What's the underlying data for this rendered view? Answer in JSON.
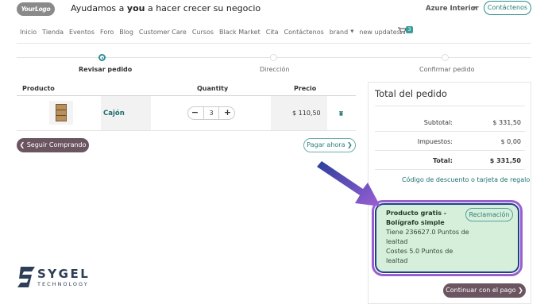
{
  "header": {
    "logo_text": "YourLogo",
    "tagline_pre": "Ayudamos a ",
    "tagline_bold": "you",
    "tagline_post": " a hacer crecer su negocio",
    "company": "Azure Interior",
    "contact_button": "Contáctenos"
  },
  "nav": {
    "items": [
      "Inicio",
      "Tienda",
      "Eventos",
      "Foro",
      "Blog",
      "Customer Care",
      "Cursos",
      "Black Market",
      "Cita",
      "Contáctenos",
      "brand",
      "new updates"
    ],
    "cart_count": "3"
  },
  "steps": [
    {
      "label": "Revisar pedido",
      "active": true
    },
    {
      "label": "Dirección",
      "active": false
    },
    {
      "label": "Confirmar pedido",
      "active": false
    }
  ],
  "table": {
    "headers": {
      "product": "Producto",
      "quantity": "Quantity",
      "price": "Precio"
    },
    "rows": [
      {
        "name": "Cajón",
        "quantity": "3",
        "price": "$ 110,50"
      }
    ]
  },
  "actions": {
    "continue_shopping": "Seguir Comprando",
    "pay_now": "Pagar ahora",
    "continue_payment": "Continuar con el pago"
  },
  "summary": {
    "title": "Total del pedido",
    "subtotal_label": "Subtotal:",
    "subtotal_value": "$ 331,50",
    "taxes_label": "Impuestos:",
    "taxes_value": "$ 0,00",
    "total_label": "Total:",
    "total_value": "$ 331,50",
    "discount_link": "Código de descuento o tarjeta de regalo"
  },
  "promo": {
    "title_line1": "Producto gratis -",
    "title_line2": "Bolígrafo simple",
    "points_line1": "Tiene 236627.0 Puntos de",
    "points_line2": "lealtad",
    "cost_line1": "Costes 5.0 Puntos de",
    "cost_line2": "lealtad",
    "claim_button": "Reclamación"
  },
  "watermark": {
    "name": "SYGEL",
    "sub": "TECHNOLOGY"
  },
  "colors": {
    "accent": "#2e9090",
    "dark_button": "#6b5560",
    "promo_bg": "#d5efda",
    "promo_outer": "#9a5fcf",
    "promo_inner": "#1f3f8a",
    "brand_navy": "#2d3e58"
  }
}
